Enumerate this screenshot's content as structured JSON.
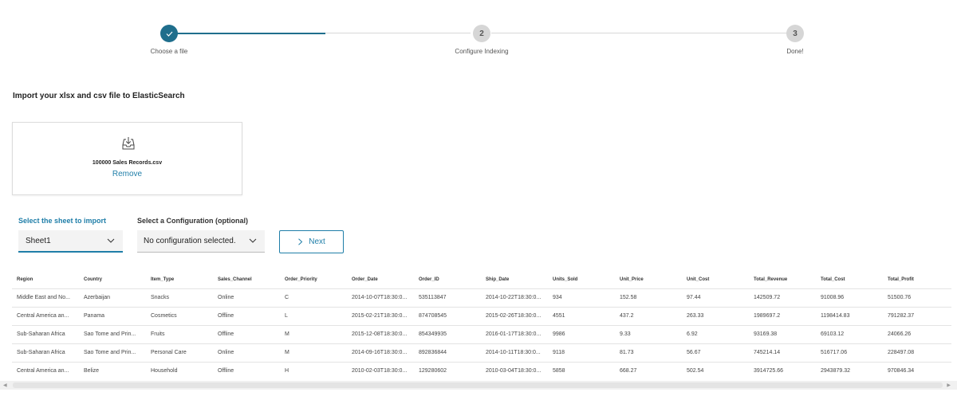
{
  "stepper": {
    "steps": [
      {
        "number": "✓",
        "label": "Choose a file",
        "state": "complete"
      },
      {
        "number": "2",
        "label": "Configure Indexing",
        "state": "pending"
      },
      {
        "number": "3",
        "label": "Done!",
        "state": "pending"
      }
    ]
  },
  "import": {
    "title": "Import your xlsx and csv file to ElasticSearch",
    "upload_icon": "download-tray-icon",
    "file_name": "100000 Sales Records.csv",
    "remove_label": "Remove"
  },
  "controls": {
    "sheet_label": "Select the sheet to import",
    "sheet_value": "Sheet1",
    "config_label": "Select a Configuration (optional)",
    "config_value": "No configuration selected.",
    "next_label": "Next"
  },
  "table": {
    "columns": [
      "Region",
      "Country",
      "Item_Type",
      "Sales_Channel",
      "Order_Priority",
      "Order_Date",
      "Order_ID",
      "Ship_Date",
      "Units_Sold",
      "Unit_Price",
      "Unit_Cost",
      "Total_Revenue",
      "Total_Cost",
      "Total_Profit"
    ],
    "rows": [
      [
        "Middle East and No...",
        "Azerbaijan",
        "Snacks",
        "Online",
        "C",
        "2014-10-07T18:30:0...",
        "535113847",
        "2014-10-22T18:30:0...",
        "934",
        "152.58",
        "97.44",
        "142509.72",
        "91008.96",
        "51500.76"
      ],
      [
        "Central America an...",
        "Panama",
        "Cosmetics",
        "Offline",
        "L",
        "2015-02-21T18:30:0...",
        "874708545",
        "2015-02-26T18:30:0...",
        "4551",
        "437.2",
        "263.33",
        "1989697.2",
        "1198414.83",
        "791282.37"
      ],
      [
        "Sub-Saharan Africa",
        "Sao Tome and Prin...",
        "Fruits",
        "Offline",
        "M",
        "2015-12-08T18:30:0...",
        "854349935",
        "2016-01-17T18:30:0...",
        "9986",
        "9.33",
        "6.92",
        "93169.38",
        "69103.12",
        "24066.26"
      ],
      [
        "Sub-Saharan Africa",
        "Sao Tome and Prin...",
        "Personal Care",
        "Online",
        "M",
        "2014-09-16T18:30:0...",
        "892836844",
        "2014-10-11T18:30:0...",
        "9118",
        "81.73",
        "56.67",
        "745214.14",
        "516717.06",
        "228497.08"
      ],
      [
        "Central America an...",
        "Belize",
        "Household",
        "Offline",
        "H",
        "2010-02-03T18:30:0...",
        "129280602",
        "2010-03-04T18:30:0...",
        "5858",
        "668.27",
        "502.54",
        "3914725.66",
        "2943879.32",
        "970846.34"
      ]
    ]
  },
  "colors": {
    "accent": "#1f6e8c",
    "link": "#1f7ea8",
    "inactive_step": "#d6d6d6"
  }
}
